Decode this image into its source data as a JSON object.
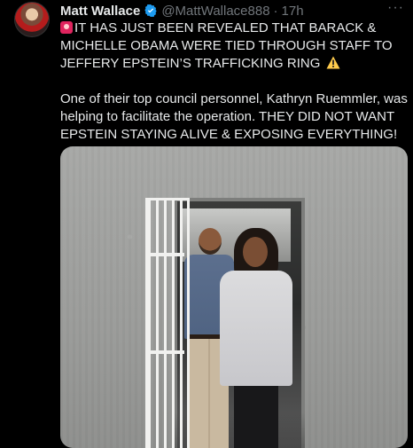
{
  "author": {
    "name": "Matt Wallace",
    "handle": "@MattWallace888",
    "separator": "·",
    "time": "17h",
    "verified_color": "#1d9bf0"
  },
  "more_label": "···",
  "tweet": {
    "paragraph1": "IT HAS JUST BEEN REVEALED THAT BARACK & MICHELLE OBAMA WERE TIED THROUGH STAFF TO JEFFERY EPSTEIN’S TRAFFICKING RING",
    "paragraph2": "One of their top council personnel, Kathryn Ruemmler, was helping to facilitate the operation. THEY DID NOT WANT EPSTEIN STAYING ALIVE & EXPOSING EVERYTHING!"
  },
  "icons": {
    "avatar": "avatar-image",
    "verified": "verified-badge-icon",
    "siren": "siren-emoji-icon",
    "warning": "warning-emoji-icon",
    "more": "more-options-icon"
  },
  "colors": {
    "background": "#000000",
    "text": "#e7e9ea",
    "secondary": "#71767b"
  }
}
